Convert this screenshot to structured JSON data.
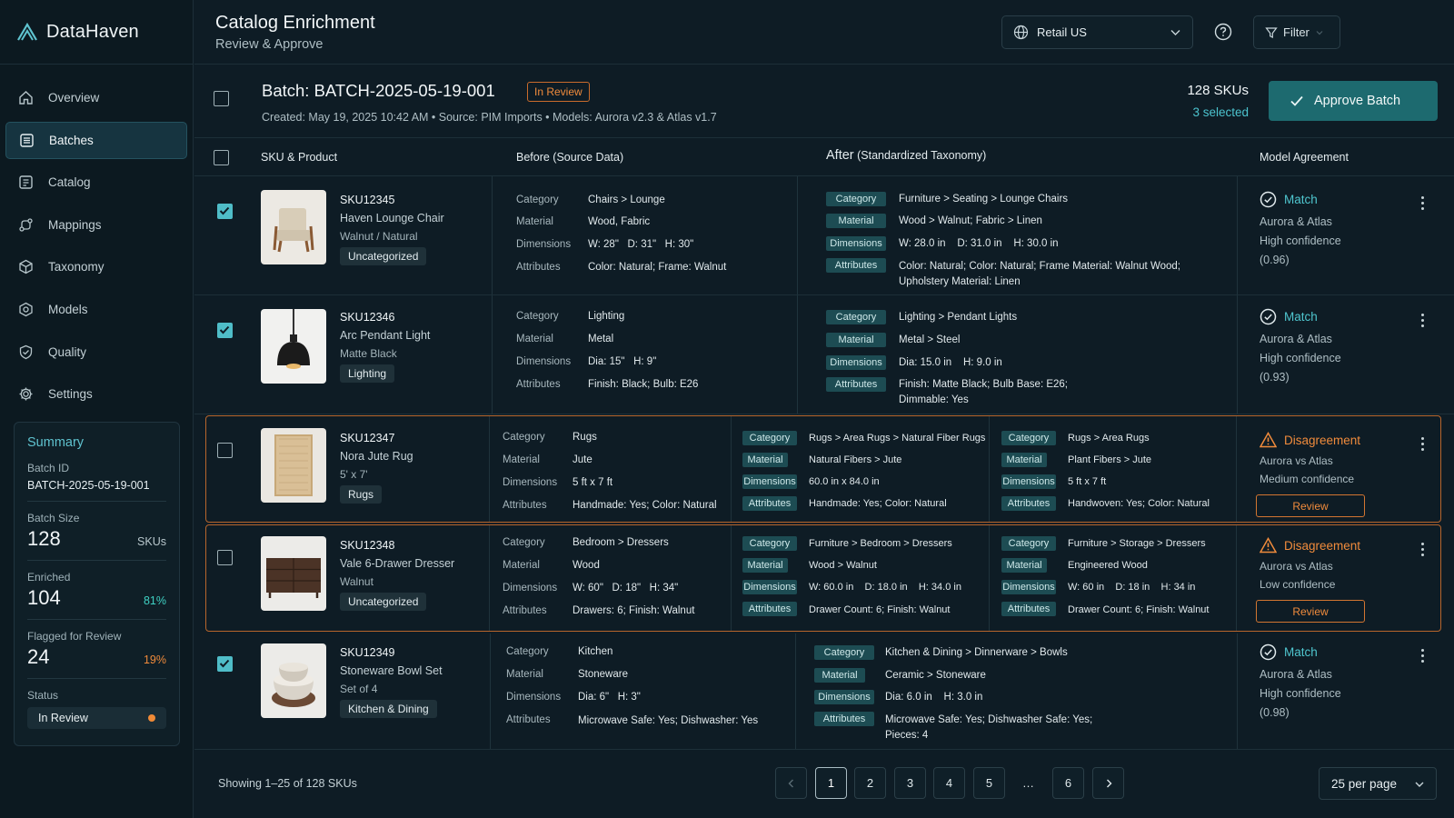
{
  "app": {
    "name": "DataHaven"
  },
  "nav": [
    {
      "label": "Overview",
      "icon": "home-icon"
    },
    {
      "label": "Batches",
      "icon": "list-icon",
      "active": true
    },
    {
      "label": "Catalog",
      "icon": "catalog-icon"
    },
    {
      "label": "Mappings",
      "icon": "mappings-icon"
    },
    {
      "label": "Taxonomy",
      "icon": "cube-icon"
    },
    {
      "label": "Models",
      "icon": "models-icon"
    },
    {
      "label": "Quality",
      "icon": "shield-check-icon"
    },
    {
      "label": "Settings",
      "icon": "gear-icon"
    }
  ],
  "summary": {
    "title": "Summary",
    "batch_id_label": "Batch ID",
    "batch_id": "BATCH-2025-05-19-001",
    "size_label": "Batch Size",
    "size": "128",
    "size_unit": "SKUs",
    "enriched_label": "Enriched",
    "enriched": "104",
    "enriched_pct": "81%",
    "flagged_label": "Flagged for Review",
    "flagged": "24",
    "flagged_pct": "19%",
    "status_label": "Status",
    "status": "In Review"
  },
  "header": {
    "title": "Catalog Enrichment",
    "subtitle": "Review & Approve",
    "region": "Retail US",
    "filter": "Filter"
  },
  "batch": {
    "title": "Batch: BATCH-2025-05-19-001",
    "status": "In Review",
    "meta": "Created: May 19, 2025 10:42 AM  •  Source: PIM Imports  •  Models: Aurora v2.3 & Atlas v1.7",
    "skus": "128 SKUs",
    "selected": "3 selected",
    "approve": "Approve Batch"
  },
  "columns": {
    "product": "SKU & Product",
    "before": "Before (Source Data)",
    "after_main": "After",
    "after_sub": "(Standardized Taxonomy)",
    "agreement": "Model Agreement"
  },
  "labels": {
    "category": "Category",
    "material": "Material",
    "dimensions": "Dimensions",
    "attributes": "Attributes",
    "review": "Review"
  },
  "rows": [
    {
      "sku": "SKU12345",
      "name": "Haven Lounge Chair",
      "variant": "Walnut / Natural",
      "chip": "Uncategorized",
      "checked": true,
      "before": {
        "category": "Chairs > Lounge",
        "material": "Wood, Fabric",
        "dimensions": "W: 28\"   D: 31\"   H: 30\"",
        "attributes": "Color: Natural; Frame: Walnut"
      },
      "after": {
        "category": "Furniture > Seating > Lounge Chairs",
        "material": "Wood > Walnut; Fabric > Linen",
        "dimensions": "W: 28.0 in    D: 31.0 in    H: 30.0 in",
        "attributes": "Color: Natural; Color: Natural; Frame Material: Walnut Wood;",
        "attributes2": "Upholstery Material: Linen"
      },
      "agree": "Match",
      "models": "Aurora & Atlas",
      "confidence": "High confidence",
      "score": "(0.96)"
    },
    {
      "sku": "SKU12346",
      "name": "Arc Pendant Light",
      "variant": "Matte Black",
      "chip": "Lighting",
      "checked": true,
      "before": {
        "category": "Lighting",
        "material": "Metal",
        "dimensions": "Dia: 15\"   H: 9\"",
        "attributes": "Finish: Black; Bulb: E26"
      },
      "after": {
        "category": "Lighting > Pendant Lights",
        "material": "Metal > Steel",
        "dimensions": "Dia: 15.0 in    H: 9.0 in",
        "attributes": "Finish: Matte Black; Bulb Base: E26;",
        "attributes2": "Dimmable: Yes"
      },
      "agree": "Match",
      "models": "Aurora & Atlas",
      "confidence": "High confidence",
      "score": "(0.93)"
    },
    {
      "sku": "SKU12347",
      "name": "Nora Jute Rug",
      "variant": "5' x 7'",
      "chip": "Rugs",
      "checked": false,
      "before": {
        "category": "Rugs",
        "material": "Jute",
        "dimensions": "5 ft x 7 ft",
        "attributes": "Handmade: Yes; Color: Natural"
      },
      "after_a": {
        "category": "Rugs > Area Rugs > Natural Fiber Rugs",
        "material": "Natural Fibers > Jute",
        "dimensions": "60.0 in x 84.0 in",
        "attributes": "Handmade: Yes; Color: Natural"
      },
      "after_b": {
        "category": "Rugs > Area Rugs",
        "material": "Plant Fibers > Jute",
        "dimensions": "5 ft x 7 ft",
        "attributes": "Handwoven: Yes; Color: Natural"
      },
      "agree": "Disagreement",
      "models": "Aurora vs Atlas",
      "confidence": "Medium confidence"
    },
    {
      "sku": "SKU12348",
      "name": "Vale 6-Drawer Dresser",
      "variant": "Walnut",
      "chip": "Uncategorized",
      "checked": false,
      "before": {
        "category": "Bedroom > Dressers",
        "material": "Wood",
        "dimensions": "W: 60\"   D: 18\"   H: 34\"",
        "attributes": "Drawers: 6; Finish: Walnut"
      },
      "after_a": {
        "category": "Furniture > Bedroom > Dressers",
        "material": "Wood > Walnut",
        "dimensions": "W: 60.0 in    D: 18.0 in    H: 34.0 in",
        "attributes": "Drawer Count: 6; Finish: Walnut"
      },
      "after_b": {
        "category": "Furniture > Storage > Dressers",
        "material": "Engineered Wood",
        "dimensions": "W: 60 in    D: 18 in    H: 34 in",
        "attributes": "Drawer Count: 6; Finish: Walnut"
      },
      "agree": "Disagreement",
      "models": "Aurora vs Atlas",
      "confidence": "Low confidence"
    },
    {
      "sku": "SKU12349",
      "name": "Stoneware Bowl Set",
      "variant": "Set of 4",
      "chip": "Kitchen & Dining",
      "checked": true,
      "before": {
        "category": "Kitchen",
        "material": "Stoneware",
        "dimensions": "Dia: 6\"   H: 3\"",
        "attributes": "Microwave Safe: Yes; Dishwasher: Yes"
      },
      "after": {
        "category": "Kitchen & Dining > Dinnerware > Bowls",
        "material": "Ceramic > Stoneware",
        "dimensions": "Dia: 6.0 in    H: 3.0 in",
        "attributes": "Microwave Safe: Yes; Dishwasher Safe: Yes;",
        "attributes2": "Pieces: 4"
      },
      "agree": "Match",
      "models": "Aurora & Atlas",
      "confidence": "High confidence",
      "score": "(0.98)"
    }
  ],
  "footer": {
    "showing": "Showing 1–25 of 128 SKUs",
    "pages": [
      "1",
      "2",
      "3",
      "4",
      "5",
      "…",
      "6"
    ],
    "per_page": "25 per page"
  },
  "colors": {
    "accent": "#4fbdc8",
    "warning": "#f08b3c",
    "tag_bg": "#1d4c53",
    "approve_bg": "#1d6a6f"
  }
}
